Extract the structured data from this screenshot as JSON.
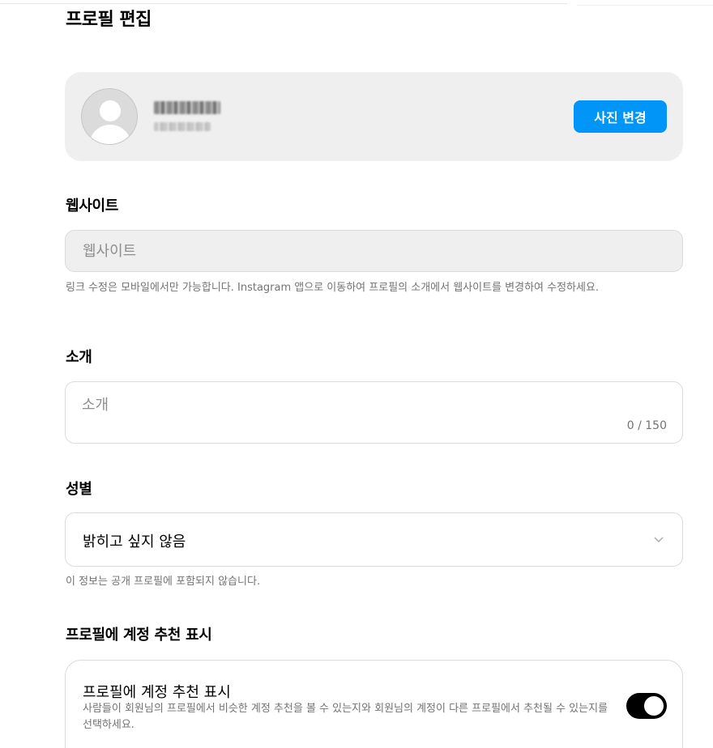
{
  "page": {
    "title": "프로필 편집"
  },
  "profile_card": {
    "change_photo_label": "사진 변경"
  },
  "website": {
    "label": "웹사이트",
    "placeholder": "웹사이트",
    "help": "링크 수정은 모바일에서만 가능합니다. Instagram 앱으로 이동하여 프로필의 소개에서 웹사이트를 변경하여 수정하세요."
  },
  "bio": {
    "label": "소개",
    "placeholder": "소개",
    "counter": "0 / 150"
  },
  "gender": {
    "label": "성별",
    "selected": "밝히고 싶지 않음",
    "help": "이 정보는 공개 프로필에 포함되지 않습니다."
  },
  "suggestions": {
    "section_label": "프로필에 계정 추천 표시",
    "title": "프로필에 계정 추천 표시",
    "description": "사람들이 회원님의 프로필에서 비슷한 계정 추천을 볼 수 있는지와 회원님의 계정이 다른 프로필에서 추천될 수 있는지를 선택하세요.",
    "enabled": true
  },
  "icons": {
    "avatar": "default-avatar-icon",
    "select_arrow": "chevron-down-icon"
  },
  "colors": {
    "primary_button": "#0095f6",
    "toggle_on": "#000000",
    "card_bg": "#efefef"
  }
}
